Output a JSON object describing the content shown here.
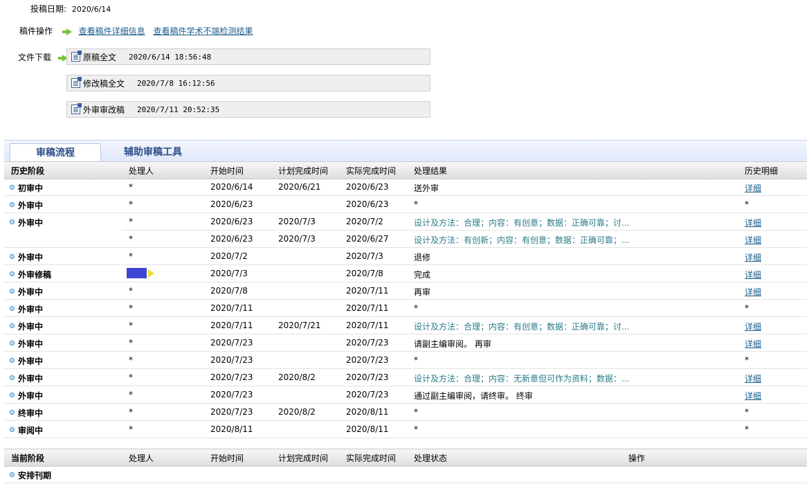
{
  "submit": {
    "label": "投稿日期:",
    "date": "2020/6/14"
  },
  "ops": {
    "label": "稿件操作",
    "link_detail": "查看稿件详细信息",
    "link_check": "查看稿件学术不端检测结果"
  },
  "downloads": {
    "label": "文件下载",
    "files": [
      {
        "name": "原稿全文",
        "time": "2020/6/14 18:56:48"
      },
      {
        "name": "修改稿全文",
        "time": "2020/7/8 16:12:56"
      },
      {
        "name": "外审审改稿",
        "time": "2020/7/11 20:52:35"
      }
    ]
  },
  "tabs": {
    "review_flow": "审稿流程",
    "assist_tools": "辅助审稿工具"
  },
  "history": {
    "headers": {
      "stage": "历史阶段",
      "handler": "处理人",
      "start": "开始时间",
      "plan": "计划完成时间",
      "actual": "实际完成时间",
      "result": "处理结果",
      "detail": "历史明细"
    },
    "rows": [
      {
        "stage": "初审中",
        "handler": "*",
        "start": "2020/6/14",
        "plan": "2020/6/21",
        "actual": "2020/6/23",
        "result": "送外审",
        "detail": "详细"
      },
      {
        "stage": "外审中",
        "handler": "*",
        "start": "2020/6/23",
        "plan": "",
        "actual": "2020/6/23",
        "result": "*",
        "detail": "*"
      },
      {
        "stage": "外审中",
        "handler": "*",
        "start": "2020/6/23",
        "plan": "2020/7/3",
        "actual": "2020/7/2",
        "result": "设计及方法：合理；内容：有创意；数据：正确可靠；讨...",
        "detail": "详细"
      },
      {
        "stage": "",
        "handler": "*",
        "start": "2020/6/23",
        "plan": "2020/7/3",
        "actual": "2020/6/27",
        "result": "设计及方法：有创新；内容：有创意；数据：正确可靠；...",
        "detail": "详细"
      },
      {
        "stage": "外审中",
        "handler": "*",
        "start": "2020/7/2",
        "plan": "",
        "actual": "2020/7/3",
        "result": "退修",
        "detail": "详细"
      },
      {
        "stage": "外审修稿",
        "handler": "",
        "start": "2020/7/3",
        "plan": "",
        "actual": "2020/7/8",
        "result": "完成",
        "detail": "详细"
      },
      {
        "stage": "外审中",
        "handler": "*",
        "start": "2020/7/8",
        "plan": "",
        "actual": "2020/7/11",
        "result": "再审",
        "detail": "详细"
      },
      {
        "stage": "外审中",
        "handler": "*",
        "start": "2020/7/11",
        "plan": "",
        "actual": "2020/7/11",
        "result": "*",
        "detail": "*"
      },
      {
        "stage": "外审中",
        "handler": "*",
        "start": "2020/7/11",
        "plan": "2020/7/21",
        "actual": "2020/7/11",
        "result": "设计及方法：合理；内容：有创意；数据：正确可靠；讨...",
        "detail": "详细"
      },
      {
        "stage": "外审中",
        "handler": "*",
        "start": "2020/7/23",
        "plan": "",
        "actual": "2020/7/23",
        "result": "请副主编审阅。 再审",
        "detail": "详细"
      },
      {
        "stage": "外审中",
        "handler": "*",
        "start": "2020/7/23",
        "plan": "",
        "actual": "2020/7/23",
        "result": "*",
        "detail": "*"
      },
      {
        "stage": "外审中",
        "handler": "*",
        "start": "2020/7/23",
        "plan": "2020/8/2",
        "actual": "2020/7/23",
        "result": "设计及方法：合理；内容：无新意但可作为资料；数据：...",
        "detail": "详细"
      },
      {
        "stage": "外审中",
        "handler": "*",
        "start": "2020/7/23",
        "plan": "",
        "actual": "2020/7/23",
        "result": "通过副主编审阅，请终审。 终审",
        "detail": "详细"
      },
      {
        "stage": "终审中",
        "handler": "*",
        "start": "2020/7/23",
        "plan": "2020/8/2",
        "actual": "2020/8/11",
        "result": "*",
        "detail": "*"
      },
      {
        "stage": "审阅中",
        "handler": "*",
        "start": "2020/8/11",
        "plan": "",
        "actual": "2020/8/11",
        "result": "*",
        "detail": "*"
      }
    ]
  },
  "current": {
    "headers": {
      "stage": "当前阶段",
      "handler": "处理人",
      "start": "开始时间",
      "plan": "计划完成时间",
      "actual": "实际完成时间",
      "status": "处理状态",
      "op": "操作"
    },
    "rows": [
      {
        "stage": "安排刊期"
      }
    ]
  },
  "colors": {
    "link": "#1d5e8c",
    "teal_result": "#2b7b8a",
    "handler_bar": "#3d46d4",
    "handler_flag": "#e9e32a",
    "arrow": "#77c23a"
  }
}
